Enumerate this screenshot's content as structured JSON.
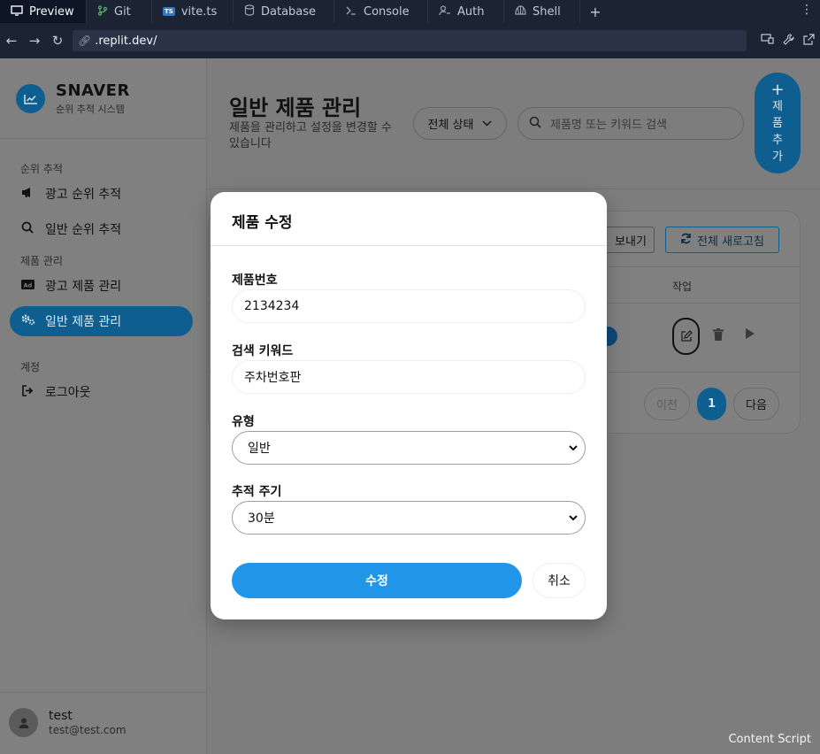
{
  "ide": {
    "tabs": [
      {
        "label": "Preview",
        "icon": "monitor-icon"
      },
      {
        "label": "Git",
        "icon": "git-branch-icon"
      },
      {
        "label": "vite.ts",
        "icon": "typescript-file-icon"
      },
      {
        "label": "Database",
        "icon": "database-icon"
      },
      {
        "label": "Console",
        "icon": "terminal-icon"
      },
      {
        "label": "Auth",
        "icon": "user-key-icon"
      },
      {
        "label": "Shell",
        "icon": "shell-icon"
      }
    ],
    "ts_badge": "TS",
    "url": ".replit.dev/"
  },
  "sidebar": {
    "brand_title": "SNAVER",
    "brand_subtitle": "순위 추적 시스템",
    "sections": [
      {
        "title": "순위 추적"
      },
      {
        "title": "제품 관리"
      },
      {
        "title": "계정"
      }
    ],
    "items": [
      {
        "label": "광고 순위 추적",
        "icon": "megaphone-icon"
      },
      {
        "label": "일반 순위 추적",
        "icon": "search-icon"
      },
      {
        "label": "광고 제품 관리",
        "icon": "ad-icon"
      },
      {
        "label": "일반 제품 관리",
        "icon": "gears-icon",
        "active": true
      },
      {
        "label": "로그아웃",
        "icon": "logout-icon"
      }
    ],
    "user": {
      "name": "test",
      "email": "test@test.com"
    }
  },
  "main": {
    "title": "일반 제품 관리",
    "description": "제품을 관리하고 설정을 변경할 수 있습니다",
    "status_filter": "전체 상태",
    "search_placeholder": "제품명 또는 키워드 검색",
    "add_button": {
      "plus": "+",
      "chars": [
        "제",
        "품",
        "추",
        "가"
      ]
    },
    "export_button": "보내기",
    "refresh_button": "전체 새로고침",
    "column_action": "작업",
    "pagination": {
      "prev": "이전",
      "current": "1",
      "next": "다음"
    }
  },
  "modal": {
    "title": "제품 수정",
    "fields": {
      "product_number": {
        "label": "제품번호",
        "value": "2134234"
      },
      "keyword": {
        "label": "검색 키워드",
        "value": "주차번호판"
      },
      "type": {
        "label": "유형",
        "value": "일반"
      },
      "interval": {
        "label": "추적 주기",
        "value": "30분"
      }
    },
    "submit": "수정",
    "cancel": "취소"
  },
  "footer_note": "Content Script",
  "colors": {
    "accent": "#2196e8",
    "accent_dimmed": "#0e5f90",
    "ide_bg": "#1c2333",
    "overlay_bg": "#7d7d7d"
  }
}
